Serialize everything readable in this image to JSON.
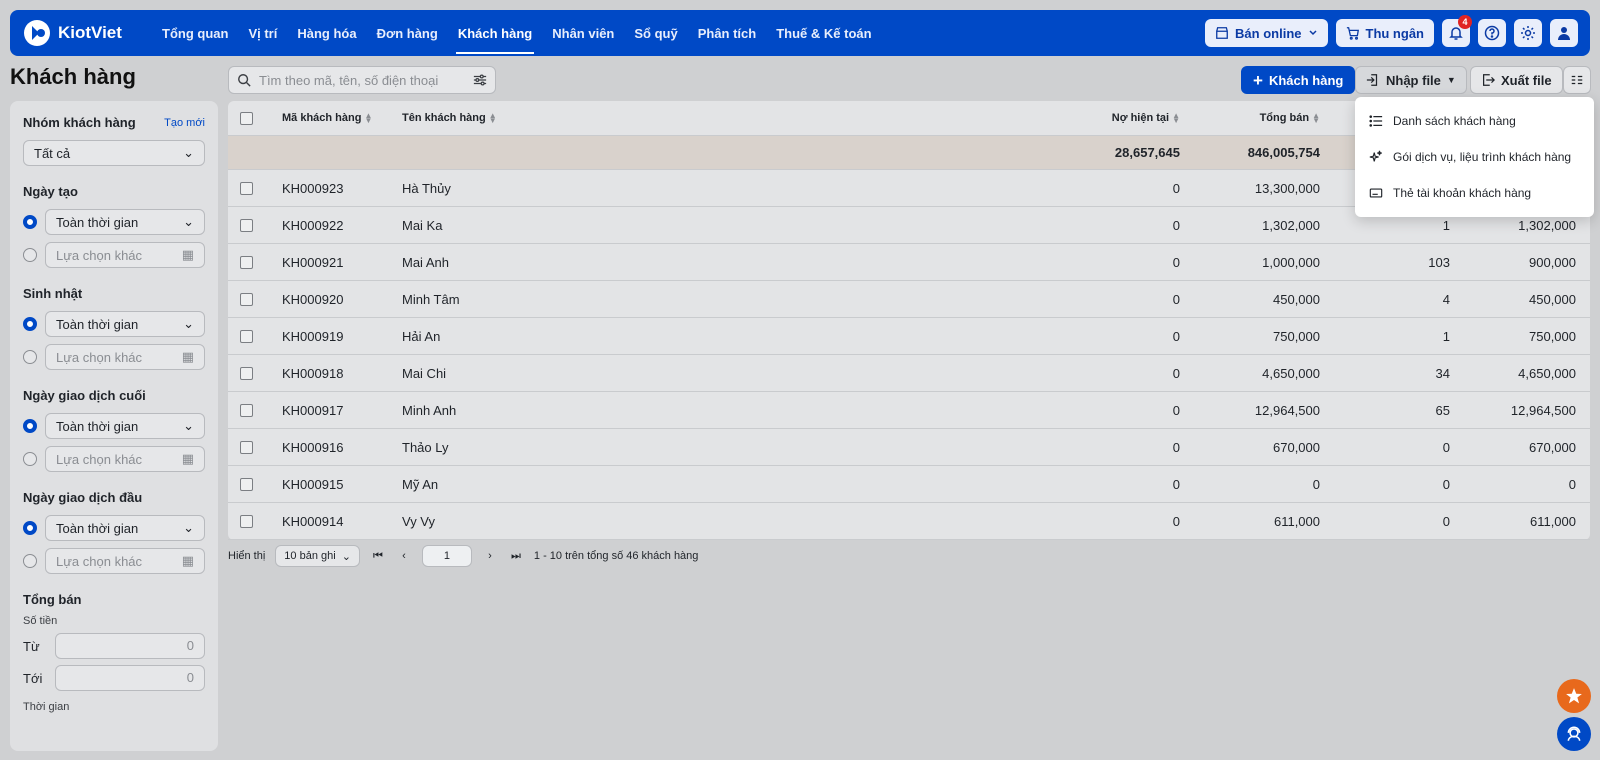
{
  "app": {
    "brand": "KiotViet",
    "nav": [
      "Tổng quan",
      "Vị trí",
      "Hàng hóa",
      "Đơn hàng",
      "Khách hàng",
      "Nhân viên",
      "Sổ quỹ",
      "Phân tích",
      "Thuế & Kế toán"
    ],
    "active_nav": "Khách hàng",
    "online_label": "Bán online",
    "cashier_label": "Thu ngân",
    "notification_count": "4",
    "icons": [
      "logo-icon",
      "store-icon",
      "cart-icon",
      "bell-icon",
      "help-icon",
      "gear-icon",
      "user-icon"
    ]
  },
  "page": {
    "title": "Khách hàng"
  },
  "sidebar": {
    "group": {
      "title": "Nhóm khách hàng",
      "create_link": "Tạo mới",
      "value": "Tất cả"
    },
    "created": {
      "title": "Ngày tạo",
      "all_time": "Toàn thời gian",
      "custom_placeholder": "Lựa chọn khác"
    },
    "birthday": {
      "title": "Sinh nhật",
      "all_time": "Toàn thời gian",
      "custom_placeholder": "Lựa chọn khác"
    },
    "last_trans": {
      "title": "Ngày giao dịch cuối",
      "all_time": "Toàn thời gian",
      "custom_placeholder": "Lựa chọn khác"
    },
    "first_trans": {
      "title": "Ngày giao dịch đầu",
      "all_time": "Toàn thời gian",
      "custom_placeholder": "Lựa chọn khác"
    },
    "total_sales": {
      "title": "Tổng bán",
      "amount_label": "Số tiền",
      "from_label": "Từ",
      "to_label": "Tới",
      "from_value": "0",
      "to_value": "0"
    },
    "time_label": "Thời gian"
  },
  "toolbar": {
    "search_placeholder": "Tìm theo mã, tên, số điện thoại",
    "add_label": "Khách hàng",
    "import_label": "Nhập file",
    "export_label": "Xuất file"
  },
  "import_menu": {
    "items": [
      "Danh sách khách hàng",
      "Gói dịch vụ, liệu trình khách hàng",
      "Thẻ tài khoản khách hàng"
    ]
  },
  "table": {
    "columns": {
      "code": "Mã khách hàng",
      "name": "Tên khách hàng",
      "debt": "Nợ hiện tại",
      "sales": "Tổng bán"
    },
    "totals": {
      "debt": "28,657,645",
      "sales": "846,005,754"
    },
    "rows": [
      {
        "code": "KH000923",
        "name": "Hà Thủy",
        "debt": "0",
        "sales": "13,300,000",
        "qty": "",
        "net": ""
      },
      {
        "code": "KH000922",
        "name": "Mai Ka",
        "debt": "0",
        "sales": "1,302,000",
        "qty": "1",
        "net": "1,302,000"
      },
      {
        "code": "KH000921",
        "name": "Mai Anh",
        "debt": "0",
        "sales": "1,000,000",
        "qty": "103",
        "net": "900,000"
      },
      {
        "code": "KH000920",
        "name": "Minh Tâm",
        "debt": "0",
        "sales": "450,000",
        "qty": "4",
        "net": "450,000"
      },
      {
        "code": "KH000919",
        "name": "Hải An",
        "debt": "0",
        "sales": "750,000",
        "qty": "1",
        "net": "750,000"
      },
      {
        "code": "KH000918",
        "name": "Mai Chi",
        "debt": "0",
        "sales": "4,650,000",
        "qty": "34",
        "net": "4,650,000"
      },
      {
        "code": "KH000917",
        "name": "Minh Anh",
        "debt": "0",
        "sales": "12,964,500",
        "qty": "65",
        "net": "12,964,500"
      },
      {
        "code": "KH000916",
        "name": "Thảo Ly",
        "debt": "0",
        "sales": "670,000",
        "qty": "0",
        "net": "670,000"
      },
      {
        "code": "KH000915",
        "name": "Mỹ An",
        "debt": "0",
        "sales": "0",
        "qty": "0",
        "net": "0"
      },
      {
        "code": "KH000914",
        "name": "Vy Vy",
        "debt": "0",
        "sales": "611,000",
        "qty": "0",
        "net": "611,000"
      }
    ]
  },
  "pager": {
    "show_label": "Hiển thị",
    "page_size": "10 bản ghi",
    "page": "1",
    "summary": "1 - 10 trên tổng số 46 khách hàng"
  },
  "colors": {
    "brand": "#0049c6",
    "accent": "#e8691c",
    "badge": "#e02424"
  }
}
